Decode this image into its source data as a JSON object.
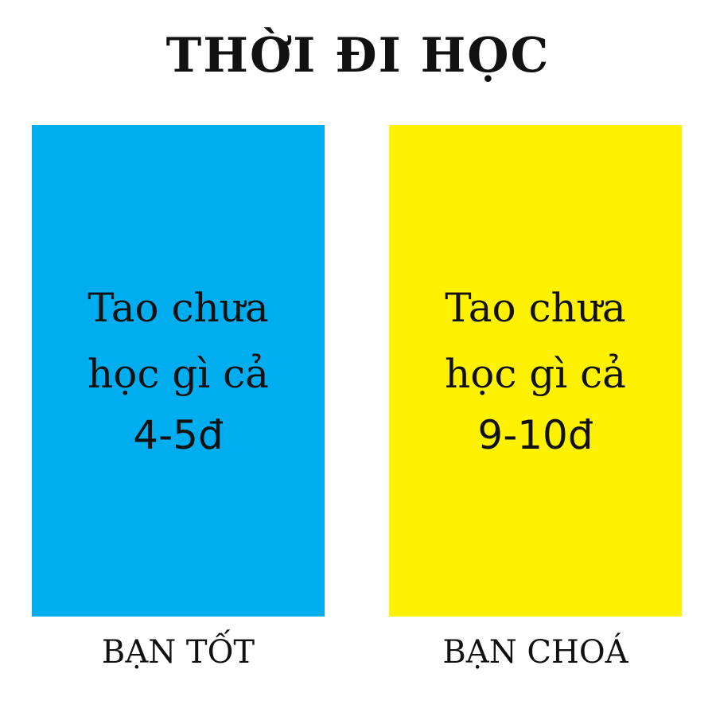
{
  "title": "THỜI ĐI HỌC",
  "panels": [
    {
      "color": "#00aeef",
      "line1": "Tao chưa",
      "line2": "học gì cả",
      "score": "4-5đ",
      "caption": "BẠN TỐT"
    },
    {
      "color": "#fff200",
      "line1": "Tao chưa",
      "line2": "học gì cả",
      "score": "9-10đ",
      "caption": "BẠN CHOÁ"
    }
  ]
}
